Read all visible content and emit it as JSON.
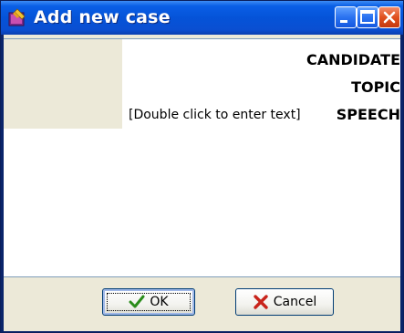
{
  "window": {
    "title": "Add new case",
    "icons": {
      "app": "notebook-pencil-icon",
      "minimize": "minimize-icon",
      "maximize": "maximize-icon",
      "close": "close-icon"
    }
  },
  "form": {
    "rows": [
      {
        "label": "CANDIDATE",
        "value": ""
      },
      {
        "label": "TOPIC",
        "value": ""
      },
      {
        "label": "SPEECH",
        "value": "[Double click to enter text]"
      }
    ]
  },
  "buttons": {
    "ok": {
      "label": "OK",
      "icon": "checkmark-icon"
    },
    "cancel": {
      "label": "Cancel",
      "icon": "x-mark-icon"
    }
  }
}
